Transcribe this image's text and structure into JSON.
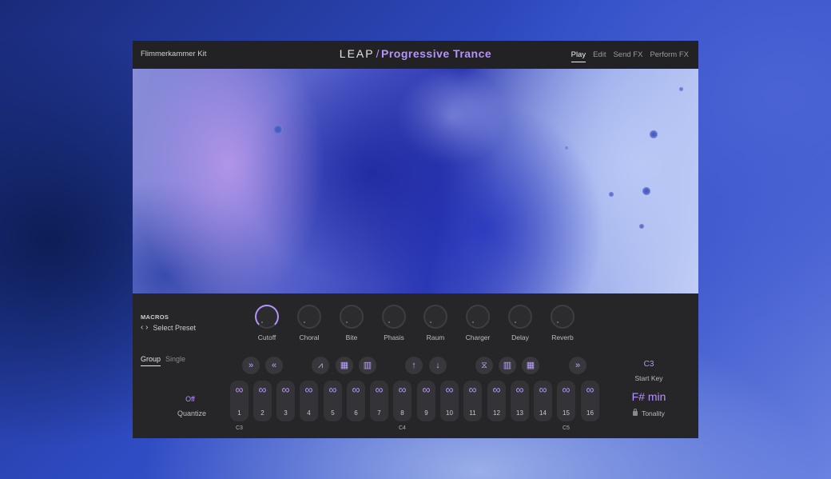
{
  "app": {
    "kit_name": "Flimmerkammer Kit",
    "logo_text": "LEAP",
    "logo_slash": "/",
    "logo_title": "Progressive Trance"
  },
  "nav": {
    "tabs": [
      {
        "label": "Play",
        "active": true
      },
      {
        "label": "Edit",
        "active": false
      },
      {
        "label": "Send FX",
        "active": false
      },
      {
        "label": "Perform FX",
        "active": false
      }
    ]
  },
  "macros": {
    "label": "MACROS",
    "preset_arrows": "‹ ›",
    "preset_label": "Select Preset",
    "knobs": [
      {
        "label": "Cutoff",
        "active": true
      },
      {
        "label": "Choral",
        "active": false
      },
      {
        "label": "Bite",
        "active": false
      },
      {
        "label": "Phasis",
        "active": false
      },
      {
        "label": "Raum",
        "active": false
      },
      {
        "label": "Charger",
        "active": false
      },
      {
        "label": "Delay",
        "active": false
      },
      {
        "label": "Reverb",
        "active": false
      }
    ]
  },
  "mode": {
    "options": [
      {
        "label": "Group",
        "active": true
      },
      {
        "label": "Single",
        "active": false
      }
    ]
  },
  "quantize": {
    "value": "Off",
    "label": "Quantize"
  },
  "fx_buttons": [
    {
      "icon": "fast-forward-icon",
      "glyph": "»"
    },
    {
      "icon": "rewind-icon",
      "glyph": "«"
    },
    {
      "icon": "filter-shape-icon",
      "glyph": "⩘"
    },
    {
      "icon": "grid-pattern-icon",
      "glyph": "▦"
    },
    {
      "icon": "gate-bars-icon",
      "glyph": "▥"
    },
    {
      "icon": "arrow-up-icon",
      "glyph": "↑"
    },
    {
      "icon": "arrow-down-icon",
      "glyph": "↓"
    },
    {
      "icon": "stutter-icon",
      "glyph": "⧖"
    },
    {
      "icon": "split-bars-icon",
      "glyph": "▥"
    },
    {
      "icon": "grid-pattern-icon",
      "glyph": "▦"
    },
    {
      "icon": "fast-forward-icon",
      "glyph": "»"
    }
  ],
  "pads": [
    "1",
    "2",
    "3",
    "4",
    "5",
    "6",
    "7",
    "8",
    "9",
    "10",
    "11",
    "12",
    "13",
    "14",
    "15",
    "16"
  ],
  "pad_icon": "∞",
  "key_labels": [
    "C3",
    "C4",
    "C5"
  ],
  "start_key": {
    "value": "C3",
    "label": "Start Key"
  },
  "tonality": {
    "value": "F# min",
    "label": "Tonality"
  },
  "colors": {
    "accent": "#b592ff",
    "panel": "#262628",
    "topbar": "#222224"
  }
}
